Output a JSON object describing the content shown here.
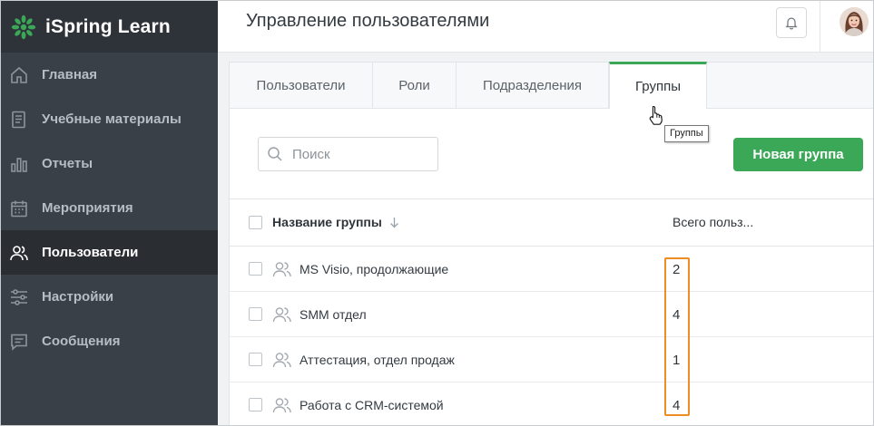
{
  "app": {
    "name": "iSpring Learn",
    "brand_color": "#3aa857"
  },
  "sidebar": {
    "items": [
      {
        "label": "Главная",
        "icon": "home-icon",
        "active": false
      },
      {
        "label": "Учебные материалы",
        "icon": "document-icon",
        "active": false
      },
      {
        "label": "Отчеты",
        "icon": "chart-icon",
        "active": false
      },
      {
        "label": "Мероприятия",
        "icon": "calendar-icon",
        "active": false
      },
      {
        "label": "Пользователи",
        "icon": "users-icon",
        "active": true
      },
      {
        "label": "Настройки",
        "icon": "sliders-icon",
        "active": false
      },
      {
        "label": "Сообщения",
        "icon": "message-icon",
        "active": false
      }
    ]
  },
  "header": {
    "title": "Управление пользователями",
    "bell_icon": "bell-icon",
    "avatar_icon": "avatar"
  },
  "tabs": [
    {
      "label": "Пользователи",
      "active": false
    },
    {
      "label": "Роли",
      "active": false
    },
    {
      "label": "Подразделения",
      "active": false
    },
    {
      "label": "Группы",
      "active": true
    }
  ],
  "tooltip": {
    "text": "Группы"
  },
  "toolbar": {
    "search_placeholder": "Поиск",
    "new_group_label": "Новая группа"
  },
  "table": {
    "columns": {
      "name": "Название группы",
      "total": "Всего польз..."
    },
    "rows": [
      {
        "name": "MS Visio, продолжающие",
        "count": "2"
      },
      {
        "name": "SMM отдел",
        "count": "4"
      },
      {
        "name": "Аттестация, отдел продаж",
        "count": "1"
      },
      {
        "name": "Работа с CRM-системой",
        "count": "4"
      }
    ]
  },
  "highlight_color": "#f08c24"
}
